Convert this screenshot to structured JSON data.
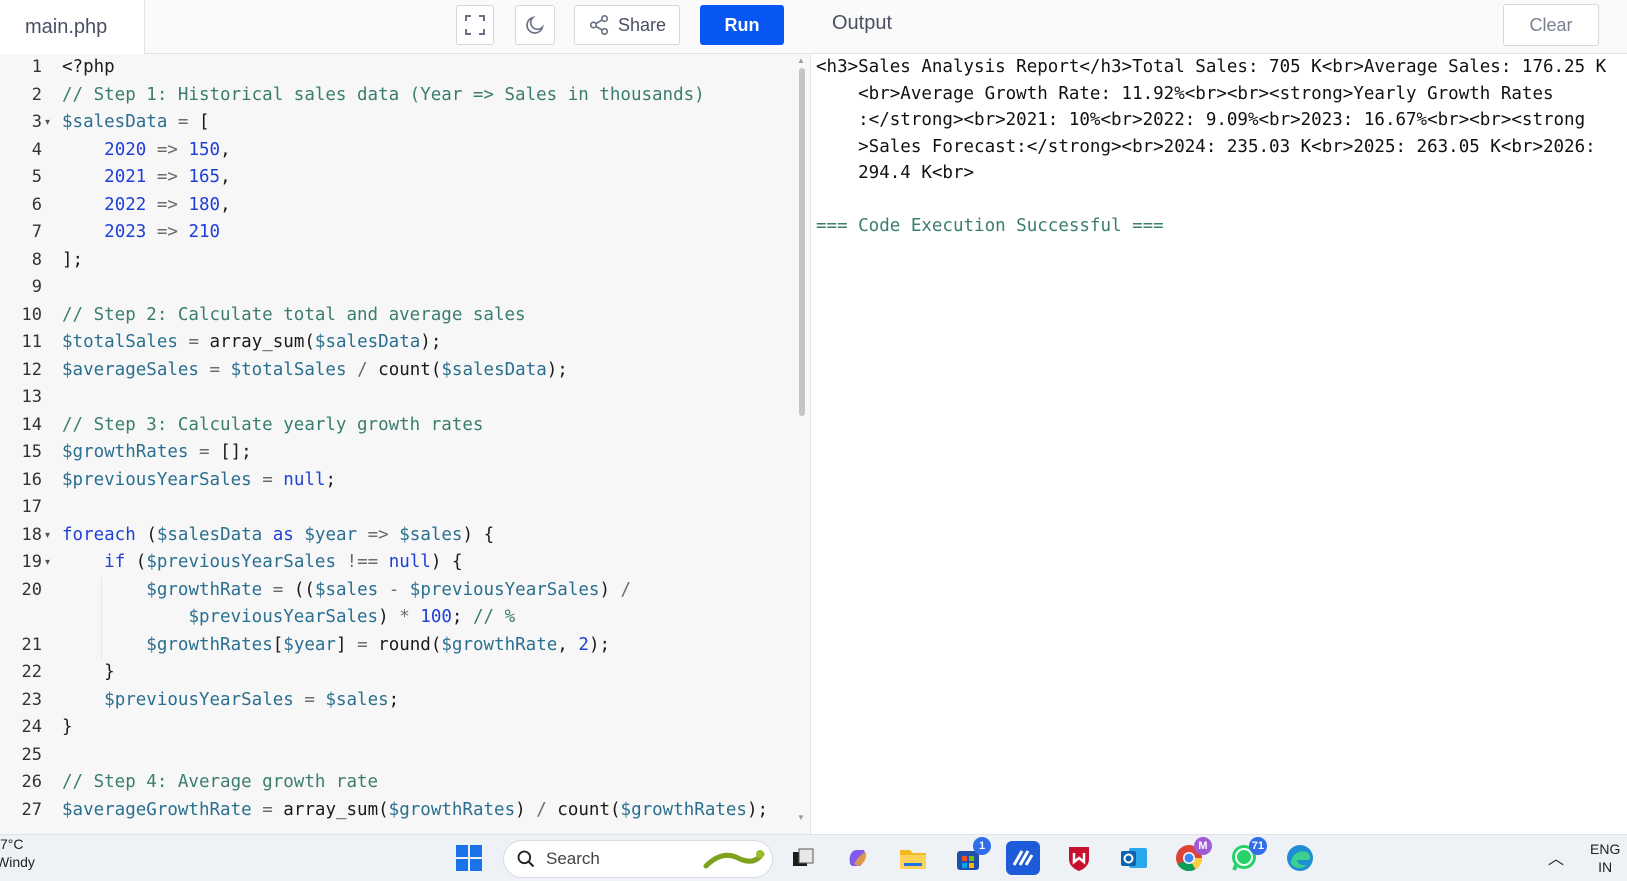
{
  "header": {
    "file_tab": "main.php",
    "share_label": "Share",
    "run_label": "Run",
    "output_title": "Output",
    "clear_label": "Clear"
  },
  "editor": {
    "line_numbers": [
      "1",
      "2",
      "3",
      "4",
      "5",
      "6",
      "7",
      "8",
      "9",
      "10",
      "11",
      "12",
      "13",
      "14",
      "15",
      "16",
      "17",
      "18",
      "19",
      "20",
      "21",
      "22",
      "23",
      "24",
      "25",
      "26",
      "27"
    ],
    "fold_markers": [
      "3",
      "18",
      "19"
    ],
    "lines": [
      "<?php",
      "// Step 1: Historical sales data (Year => Sales in thousands)",
      "$salesData = [",
      "    2020 => 150,",
      "    2021 => 165,",
      "    2022 => 180,",
      "    2023 => 210",
      "];",
      "",
      "// Step 2: Calculate total and average sales",
      "$totalSales = array_sum($salesData);",
      "$averageSales = $totalSales / count($salesData);",
      "",
      "// Step 3: Calculate yearly growth rates",
      "$growthRates = [];",
      "$previousYearSales = null;",
      "",
      "foreach ($salesData as $year => $sales) {",
      "    if ($previousYearSales !== null) {",
      "        $growthRate = (($sales - $previousYearSales) /",
      "            $previousYearSales) * 100; // %",
      "        $growthRates[$year] = round($growthRate, 2);",
      "    }",
      "    $previousYearSales = $sales;",
      "}",
      "",
      "// Step 4: Average growth rate",
      "$averageGrowthRate = array_sum($growthRates) / count($growthRates);"
    ]
  },
  "output": {
    "lines": [
      "<h3>Sales Analysis Report</h3>Total Sales: 705 K<br>Average Sales: 176.25 K",
      "    <br>Average Growth Rate: 11.92%<br><br><strong>Yearly Growth Rates",
      "    :</strong><br>2021: 10%<br>2022: 9.09%<br>2023: 16.67%<br><br><strong",
      "    >Sales Forecast:</strong><br>2024: 235.03 K<br>2025: 263.05 K<br>2026:",
      "    294.4 K<br>"
    ],
    "status": "=== Code Execution Successful ==="
  },
  "taskbar": {
    "weather_temp": "7°C",
    "weather_desc": "Windy",
    "search_placeholder": "Search",
    "store_badge": "1",
    "whatsapp_badge": "71",
    "chrome_badge": "M",
    "lang_top": "ENG",
    "lang_bottom": "IN"
  },
  "colors": {
    "run_button": "#0556f3",
    "comment": "#3a7d6e",
    "variable": "#2a6f8f",
    "number_keyword": "#1f3fd6"
  }
}
